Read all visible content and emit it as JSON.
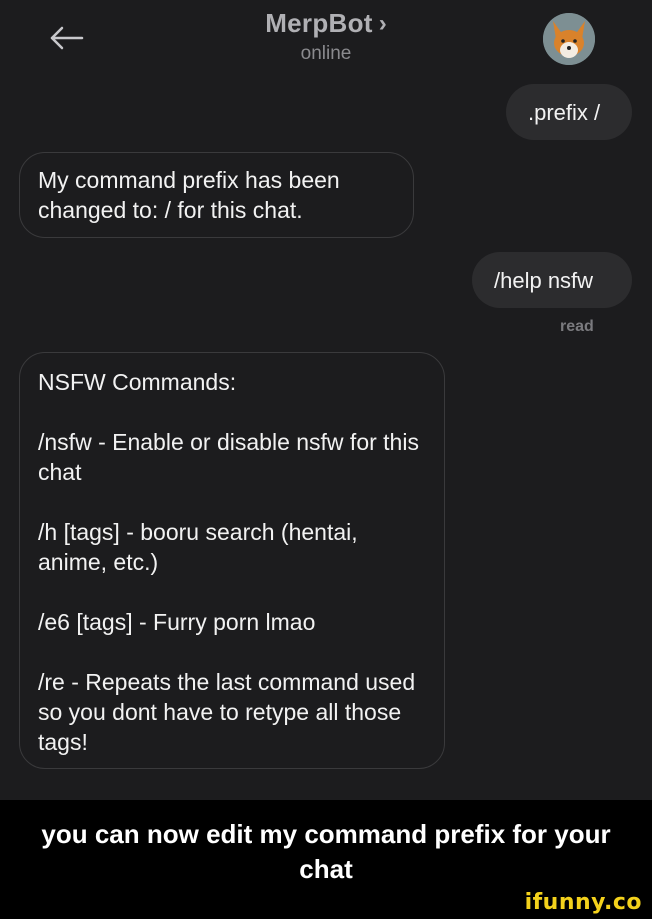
{
  "header": {
    "back_icon": "back-arrow-icon",
    "title": "MerpBot",
    "title_chevron": "›",
    "subtitle": "online",
    "avatar_icon": "fox-avatar-icon"
  },
  "messages": {
    "out_1": ".prefix /",
    "in_1": "My command prefix has been changed to: / for this chat.",
    "out_2": "/help nsfw",
    "read_receipt": "read",
    "in_2": {
      "heading": "NSFW Commands:",
      "cmd_1": "/nsfw - Enable or disable nsfw for this chat",
      "cmd_2": "/h [tags] - booru search (hentai, anime, etc.)",
      "cmd_3": "/e6 [tags] - Furry porn lmao",
      "cmd_4": "/re - Repeats the last command used so you dont have to retype all those tags!"
    }
  },
  "caption": {
    "text": "you can now edit my command prefix for your chat",
    "watermark": "ifunny.co"
  },
  "colors": {
    "background": "#1c1c1e",
    "bubble_out": "#2c2c2e",
    "bubble_border": "#3a3a3c",
    "watermark": "#f4d21c"
  }
}
